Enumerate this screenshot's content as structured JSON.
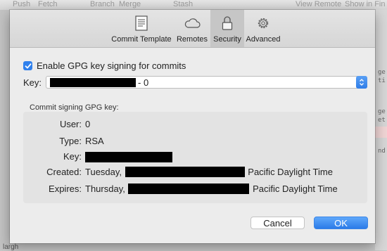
{
  "background": {
    "toolbar_items": [
      "Push",
      "Fetch",
      "Branch",
      "Merge",
      "Stash",
      "View Remote",
      "Show in Fin"
    ],
    "right_fragments": [
      "ge",
      "ti",
      "ge",
      "et",
      "nd"
    ],
    "bottom_fragment": "largh"
  },
  "tabs": [
    {
      "label": "Commit Template",
      "icon": "document-icon"
    },
    {
      "label": "Remotes",
      "icon": "cloud-icon"
    },
    {
      "label": "Security",
      "icon": "lock-icon",
      "selected": true
    },
    {
      "label": "Advanced",
      "icon": "gear-icon"
    }
  ],
  "gpg": {
    "checkbox_label": "Enable GPG key signing for commits",
    "checked": true,
    "key_label": "Key:",
    "key_value_suffix": "- 0"
  },
  "signing": {
    "section_title": "Commit signing GPG key:",
    "rows": [
      {
        "label": "User:",
        "value": "0"
      },
      {
        "label": "Type:",
        "value": "RSA"
      },
      {
        "label": "Key:",
        "value": ""
      },
      {
        "label": "Created:",
        "value_prefix": "Tuesday,",
        "value_suffix": "Pacific Daylight Time"
      },
      {
        "label": "Expires:",
        "value_prefix": "Thursday,",
        "value_suffix": "Pacific Daylight Time"
      }
    ]
  },
  "buttons": {
    "cancel": "Cancel",
    "ok": "OK"
  },
  "colors": {
    "accent": "#2f80ed",
    "ok_button": "#2b7be8",
    "dialog_bg": "#ececec"
  }
}
